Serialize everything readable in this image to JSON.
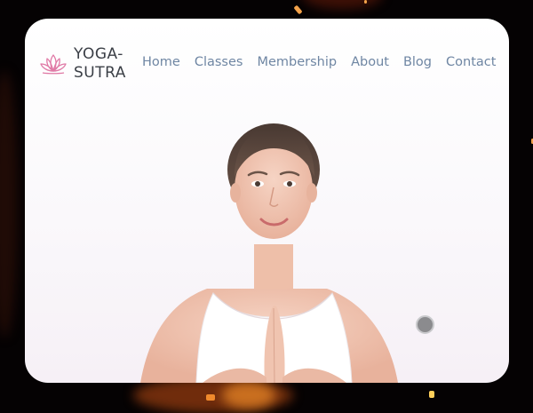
{
  "brand": {
    "line1": "YOGA-",
    "line2": "SUTRA",
    "accent": "#e07aa6"
  },
  "nav": [
    {
      "label": "Home"
    },
    {
      "label": "Classes"
    },
    {
      "label": "Membership"
    },
    {
      "label": "About"
    },
    {
      "label": "Blog"
    },
    {
      "label": "Contact"
    }
  ],
  "hero": {
    "image": "woman-prayer-pose-photo"
  },
  "colors": {
    "nav_text": "#6f86a3",
    "brand_text": "#3b3f46",
    "background": "#050203"
  },
  "icons": {
    "logo": "lotus-icon",
    "slider": "slider-dot-icon"
  }
}
